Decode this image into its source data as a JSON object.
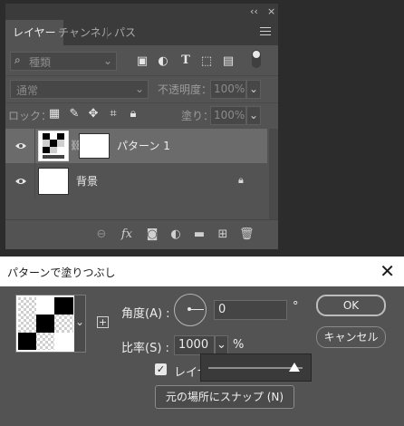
{
  "panel": {
    "tabs": [
      {
        "label": "レイヤー",
        "active": true
      },
      {
        "label": "チャンネル",
        "active": false
      },
      {
        "label": "パス",
        "active": false
      }
    ],
    "collapse_glyph": "‹‹",
    "close_glyph": "×",
    "filter_placeholder": "種類",
    "blend_mode": "通常",
    "opacity_label": "不透明度：",
    "opacity_value": "100%",
    "lock_label": "ロック：",
    "fill_label": "塗り：",
    "fill_value": "100%",
    "layers": [
      {
        "name": "パターン 1",
        "selected": true,
        "locked": false
      },
      {
        "name": "背景",
        "selected": false,
        "locked": true
      }
    ],
    "footer_icons": [
      "link-icon",
      "fx-icon",
      "mask-icon",
      "adjustment-icon",
      "folder-icon",
      "new-layer-icon",
      "trash-icon"
    ]
  },
  "dialog": {
    "title": "パターンで塗りつぶし",
    "angle_label": "角度(A) :",
    "angle_value": "0",
    "angle_unit": "°",
    "scale_label": "比率(S) :",
    "scale_value": "1000",
    "scale_unit": "%",
    "link_checkbox_label": "レイヤ",
    "link_checked": true,
    "snap_button": "元の場所にスナップ (N)",
    "ok_button": "OK",
    "cancel_button": "キャンセル"
  }
}
